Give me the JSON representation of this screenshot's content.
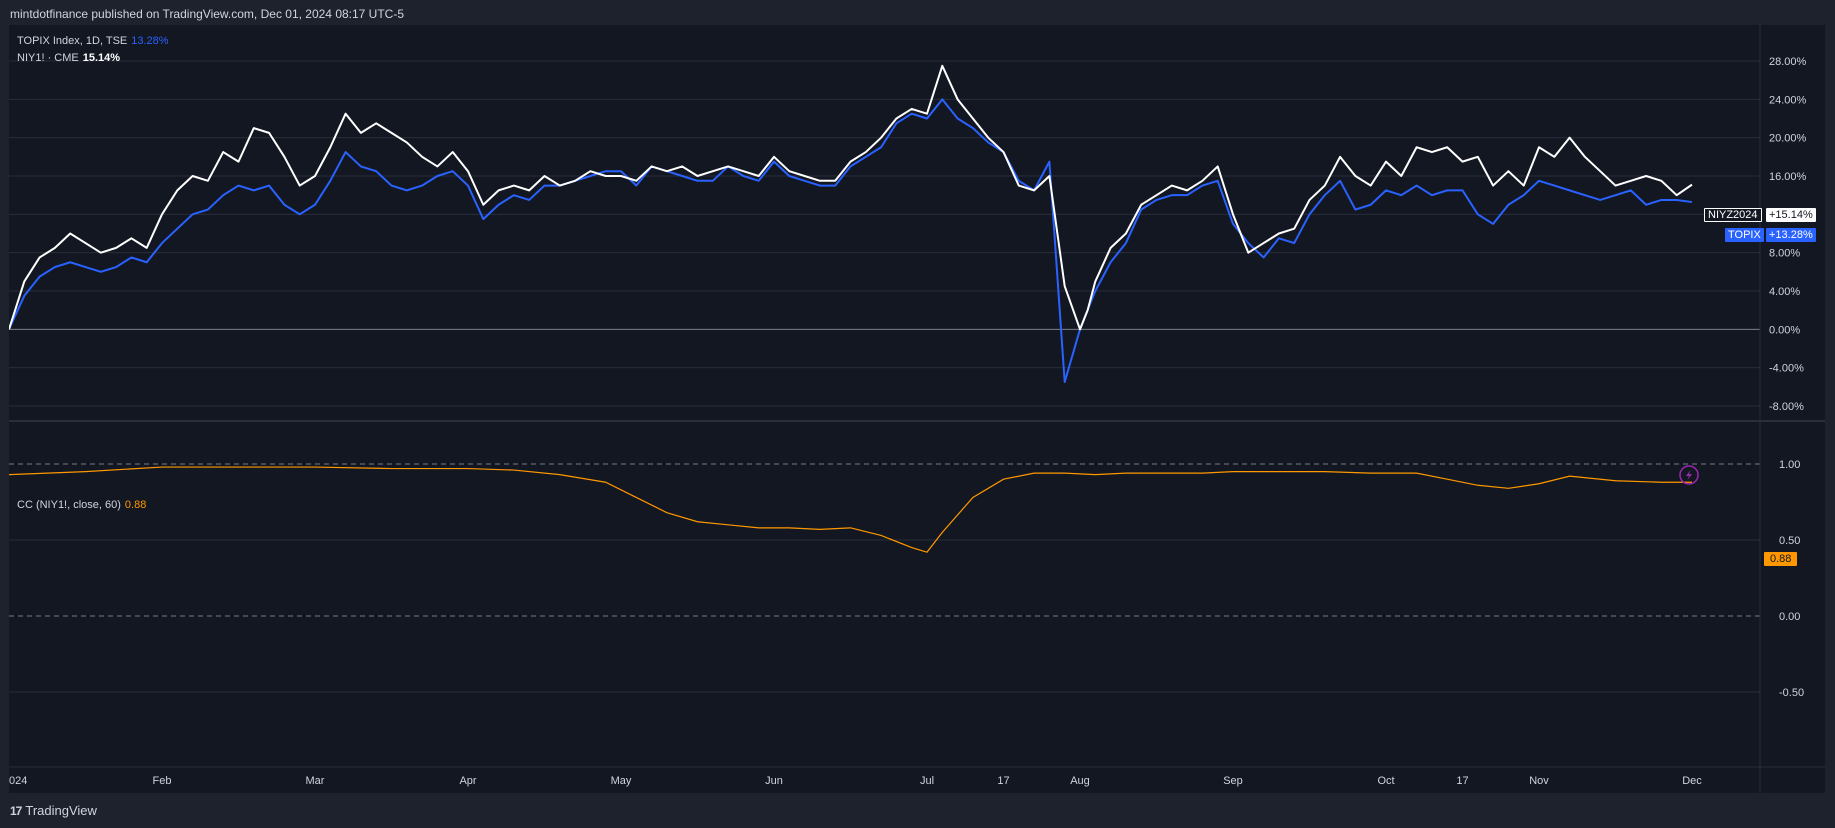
{
  "header": {
    "published": "mintdotfinance published on TradingView.com, Dec 01, 2024 08:17 UTC-5"
  },
  "legend": {
    "topix_label": "TOPIX Index, 1D, TSE",
    "topix_value": "13.28%",
    "niy_label": "NIY1! · CME",
    "niy_value": "15.14%",
    "cc_label": "CC (NIY1!, close, 60)",
    "cc_value": "0.88"
  },
  "badges": {
    "niy_name": "NIYZ2024",
    "niy_change": "+15.14%",
    "topix_name": "TOPIX",
    "topix_change": "+13.28%",
    "cc_value": "0.88"
  },
  "footer": {
    "brand": "TradingView",
    "brand_mark": "17"
  },
  "colors": {
    "background": "#131722",
    "grid": "#2a2e39",
    "topix": "#2962ff",
    "niy": "#ffffff",
    "cc": "#ff9800",
    "text": "#d1d4dc",
    "flash_icon": "#9c27b0"
  },
  "chart_data": [
    {
      "type": "line",
      "title": "",
      "x_axis_labels": [
        "024",
        "Feb",
        "Mar",
        "Apr",
        "May",
        "Jun",
        "Jul",
        "17",
        "Aug",
        "Sep",
        "Oct",
        "17",
        "Nov",
        "Dec"
      ],
      "x_label_positions_months": [
        0,
        1,
        2,
        3,
        4,
        5,
        6,
        6.5,
        7,
        8,
        9,
        9.5,
        10,
        11
      ],
      "y_ticks": [
        "28.00%",
        "24.00%",
        "20.00%",
        "16.00%",
        "12.00%",
        "8.00%",
        "4.00%",
        "0.00%",
        "-4.00%",
        "-8.00%"
      ],
      "ylim": [
        -8,
        28
      ],
      "ylabel": "",
      "series": [
        {
          "name": "NIY1!",
          "x": [
            0,
            0.1,
            0.2,
            0.3,
            0.4,
            0.5,
            0.6,
            0.7,
            0.8,
            0.9,
            1.0,
            1.1,
            1.2,
            1.3,
            1.4,
            1.5,
            1.6,
            1.7,
            1.8,
            1.9,
            2.0,
            2.1,
            2.2,
            2.3,
            2.4,
            2.5,
            2.6,
            2.7,
            2.8,
            2.9,
            3.0,
            3.1,
            3.2,
            3.3,
            3.4,
            3.5,
            3.6,
            3.7,
            3.8,
            3.9,
            4.0,
            4.1,
            4.2,
            4.3,
            4.4,
            4.5,
            4.6,
            4.7,
            4.8,
            4.9,
            5.0,
            5.1,
            5.2,
            5.3,
            5.4,
            5.5,
            5.6,
            5.7,
            5.8,
            5.9,
            6.0,
            6.1,
            6.2,
            6.3,
            6.4,
            6.5,
            6.6,
            6.7,
            6.8,
            6.9,
            7.0,
            7.05,
            7.1,
            7.2,
            7.3,
            7.4,
            7.5,
            7.6,
            7.7,
            7.8,
            7.9,
            8.0,
            8.1,
            8.2,
            8.3,
            8.4,
            8.5,
            8.6,
            8.7,
            8.8,
            8.9,
            9.0,
            9.1,
            9.2,
            9.3,
            9.4,
            9.5,
            9.6,
            9.7,
            9.8,
            9.9,
            10.0,
            10.1,
            10.2,
            10.3,
            10.4,
            10.5,
            10.6,
            10.7,
            10.8,
            10.9,
            11.0
          ],
          "values": [
            0,
            5.0,
            7.5,
            8.5,
            10.0,
            9.0,
            8.0,
            8.5,
            9.5,
            8.5,
            12.0,
            14.5,
            16.0,
            15.5,
            18.5,
            17.5,
            21.0,
            20.5,
            18.0,
            15.0,
            16.0,
            19.0,
            22.5,
            20.5,
            21.5,
            20.5,
            19.5,
            18.0,
            17.0,
            18.5,
            16.5,
            13.0,
            14.5,
            15.0,
            14.5,
            16.0,
            15.0,
            15.5,
            16.5,
            16.0,
            16.0,
            15.5,
            17.0,
            16.5,
            17.0,
            16.0,
            16.5,
            17.0,
            16.5,
            16.0,
            18.0,
            16.5,
            16.0,
            15.5,
            15.5,
            17.5,
            18.5,
            20.0,
            22.0,
            23.0,
            22.5,
            27.5,
            24.0,
            22.0,
            20.0,
            18.5,
            15.0,
            14.5,
            16.0,
            4.5,
            0.0,
            2.0,
            5.0,
            8.5,
            10.0,
            13.0,
            14.0,
            15.0,
            14.5,
            15.5,
            17.0,
            12.0,
            8.0,
            9.0,
            10.0,
            10.5,
            13.5,
            15.0,
            18.0,
            16.0,
            15.0,
            17.5,
            16.0,
            19.0,
            18.5,
            19.0,
            17.5,
            18.0,
            15.0,
            16.5,
            15.0,
            19.0,
            18.0,
            20.0,
            18.0,
            16.5,
            15.0,
            15.5,
            16.0,
            15.5,
            14.0,
            15.1
          ]
        },
        {
          "name": "TOPIX",
          "x": [
            0,
            0.1,
            0.2,
            0.3,
            0.4,
            0.5,
            0.6,
            0.7,
            0.8,
            0.9,
            1.0,
            1.1,
            1.2,
            1.3,
            1.4,
            1.5,
            1.6,
            1.7,
            1.8,
            1.9,
            2.0,
            2.1,
            2.2,
            2.3,
            2.4,
            2.5,
            2.6,
            2.7,
            2.8,
            2.9,
            3.0,
            3.1,
            3.2,
            3.3,
            3.4,
            3.5,
            3.6,
            3.7,
            3.8,
            3.9,
            4.0,
            4.1,
            4.2,
            4.3,
            4.4,
            4.5,
            4.6,
            4.7,
            4.8,
            4.9,
            5.0,
            5.1,
            5.2,
            5.3,
            5.4,
            5.5,
            5.6,
            5.7,
            5.8,
            5.9,
            6.0,
            6.1,
            6.2,
            6.3,
            6.4,
            6.5,
            6.6,
            6.7,
            6.8,
            6.9,
            7.0,
            7.05,
            7.1,
            7.2,
            7.3,
            7.4,
            7.5,
            7.6,
            7.7,
            7.8,
            7.9,
            8.0,
            8.1,
            8.2,
            8.3,
            8.4,
            8.5,
            8.6,
            8.7,
            8.8,
            8.9,
            9.0,
            9.1,
            9.2,
            9.3,
            9.4,
            9.5,
            9.6,
            9.7,
            9.8,
            9.9,
            10.0,
            10.1,
            10.2,
            10.3,
            10.4,
            10.5,
            10.6,
            10.7,
            10.8,
            10.9,
            11.0
          ],
          "values": [
            0,
            3.5,
            5.5,
            6.5,
            7.0,
            6.5,
            6.0,
            6.5,
            7.5,
            7.0,
            9.0,
            10.5,
            12.0,
            12.5,
            14.0,
            15.0,
            14.5,
            15.0,
            13.0,
            12.0,
            13.0,
            15.5,
            18.5,
            17.0,
            16.5,
            15.0,
            14.5,
            15.0,
            16.0,
            16.5,
            15.0,
            11.5,
            13.0,
            14.0,
            13.5,
            15.0,
            15.0,
            15.5,
            16.0,
            16.5,
            16.5,
            15.0,
            17.0,
            16.5,
            16.0,
            15.5,
            15.5,
            17.0,
            16.0,
            15.5,
            17.5,
            16.0,
            15.5,
            15.0,
            15.0,
            17.0,
            18.0,
            19.0,
            21.5,
            22.5,
            22.0,
            24.0,
            22.0,
            21.0,
            19.5,
            18.5,
            15.5,
            14.5,
            17.5,
            -5.5,
            0.0,
            2.0,
            4.0,
            7.0,
            9.0,
            12.5,
            13.5,
            14.0,
            14.0,
            15.0,
            15.5,
            11.0,
            9.0,
            7.5,
            9.5,
            9.0,
            12.0,
            14.0,
            15.5,
            12.5,
            13.0,
            14.5,
            14.0,
            15.0,
            14.0,
            14.5,
            14.5,
            12.0,
            11.0,
            13.0,
            14.0,
            15.5,
            15.0,
            14.5,
            14.0,
            13.5,
            14.0,
            14.5,
            13.0,
            13.5,
            13.5,
            13.28
          ]
        }
      ]
    },
    {
      "type": "line",
      "title": "CC (NIY1!, close, 60)",
      "y_ticks": [
        "1.00",
        "0.50",
        "0.00",
        "-0.50"
      ],
      "ylim": [
        -0.6,
        1.1
      ],
      "series": [
        {
          "name": "CC",
          "x": [
            0,
            0.5,
            1.0,
            1.5,
            2.0,
            2.5,
            3.0,
            3.3,
            3.6,
            3.9,
            4.1,
            4.3,
            4.5,
            4.7,
            4.9,
            5.1,
            5.3,
            5.5,
            5.7,
            5.9,
            6.0,
            6.1,
            6.3,
            6.5,
            6.7,
            6.9,
            7.1,
            7.3,
            7.5,
            7.8,
            8.0,
            8.3,
            8.6,
            8.9,
            9.2,
            9.4,
            9.6,
            9.8,
            10.0,
            10.2,
            10.5,
            10.8,
            11.0
          ],
          "values": [
            0.93,
            0.95,
            0.98,
            0.98,
            0.98,
            0.97,
            0.97,
            0.96,
            0.93,
            0.88,
            0.78,
            0.68,
            0.62,
            0.6,
            0.58,
            0.58,
            0.57,
            0.58,
            0.53,
            0.45,
            0.42,
            0.55,
            0.78,
            0.9,
            0.94,
            0.94,
            0.93,
            0.94,
            0.94,
            0.94,
            0.95,
            0.95,
            0.95,
            0.94,
            0.94,
            0.9,
            0.86,
            0.84,
            0.87,
            0.92,
            0.89,
            0.88,
            0.88
          ]
        }
      ]
    }
  ]
}
